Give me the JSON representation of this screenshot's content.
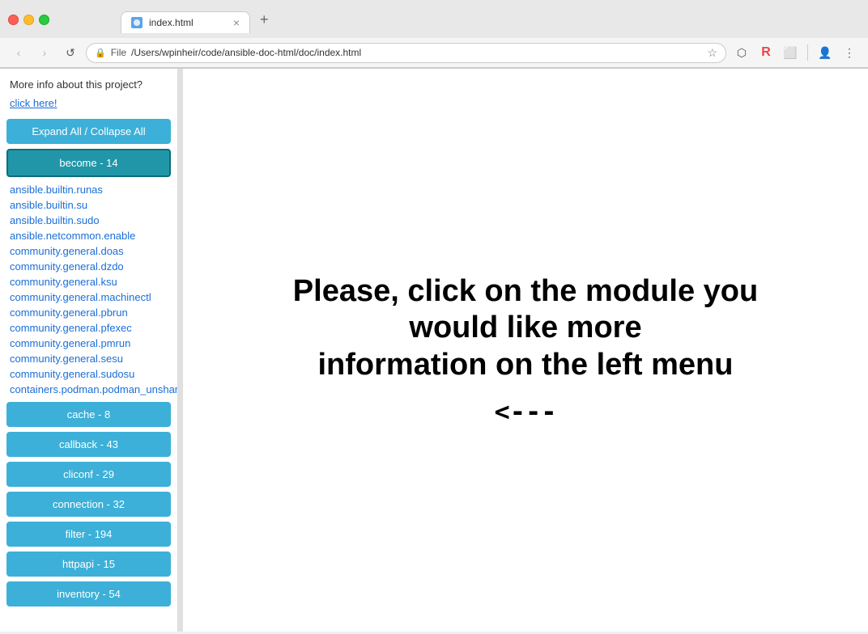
{
  "browser": {
    "title_bar": {
      "tab_title": "index.html",
      "tab_close": "×",
      "tab_new": "+"
    },
    "nav": {
      "back_arrow": "‹",
      "forward_arrow": "›",
      "reload": "↺",
      "file_label": "File",
      "url": "/Users/wpinheir/code/ansible-doc-html/doc/index.html",
      "star": "☆",
      "more": "⋮",
      "chevron_down": "⌄"
    }
  },
  "sidebar": {
    "more_info": "More info about this project?",
    "click_here": "click here!",
    "expand_btn": "Expand All / Collapse All",
    "become_btn": "become - 14",
    "modules": [
      "ansible.builtin.runas",
      "ansible.builtin.su",
      "ansible.builtin.sudo",
      "ansible.netcommon.enable",
      "community.general.doas",
      "community.general.dzdo",
      "community.general.ksu",
      "community.general.machinectl",
      "community.general.pbrun",
      "community.general.pfexec",
      "community.general.pmrun",
      "community.general.sesu",
      "community.general.sudosu",
      "containers.podman.podman_unshare"
    ],
    "cache_btn": "cache - 8",
    "callback_btn": "callback - 43",
    "cliconf_btn": "cliconf - 29",
    "connection_btn": "connection - 32",
    "filter_btn": "filter - 194",
    "httpapi_btn": "httpapi - 15",
    "inventory_btn": "inventory - 54"
  },
  "content": {
    "welcome_line1": "Please, click on the module you would like more",
    "welcome_line2": "information on the left menu",
    "arrow": "<---"
  }
}
